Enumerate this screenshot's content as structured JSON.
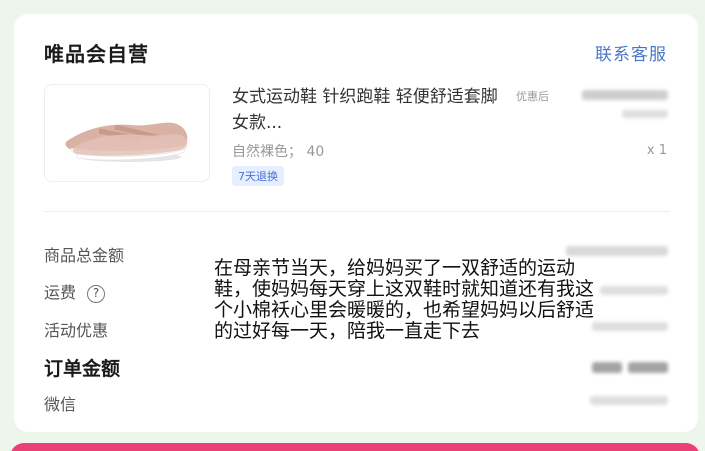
{
  "store": {
    "name": "唯品会自营",
    "contact_label": "联系客服"
  },
  "product": {
    "title": "女式运动鞋 针织跑鞋 轻便舒适套脚女款...",
    "variant": "自然裸色； 40",
    "badge": "7天退换",
    "price_label": "优惠后",
    "quantity": "x 1",
    "image_icon": "shoe-image"
  },
  "summary": {
    "rows": [
      {
        "label": "商品总金额"
      },
      {
        "label": "运费",
        "help_icon": "?"
      },
      {
        "label": "活动优惠"
      },
      {
        "label": "订单金额"
      },
      {
        "label": "微信"
      }
    ]
  },
  "note": "在母亲节当天，给妈妈买了一双舒适的运动鞋，使妈妈每天穿上这双鞋时就知道还有我这个小棉袄心里会暖暖的，也希望妈妈以后舒适的过好每一天，陪我一直走下去",
  "colors": {
    "link": "#4a78c8",
    "badge": "#4a6fd8",
    "bottom_bar": "#ec3f78"
  }
}
